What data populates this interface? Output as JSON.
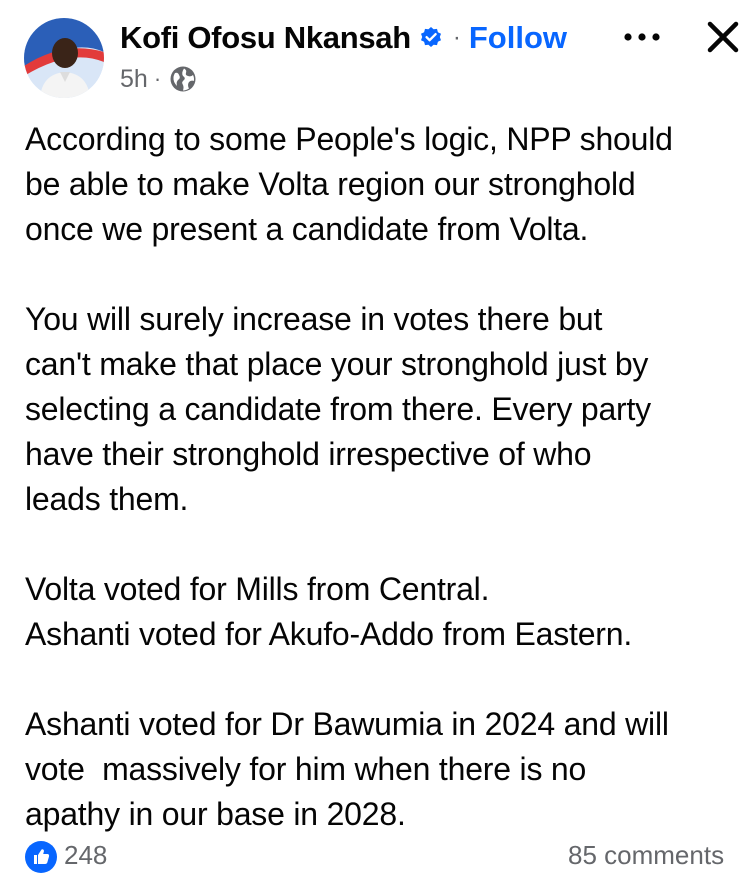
{
  "post": {
    "author": "Kofi Ofosu Nkansah",
    "separator": "·",
    "follow_label": "Follow",
    "time": "5h",
    "meta_separator": "·",
    "icons": {
      "verified": "verified-badge-icon",
      "more": "more-options-icon",
      "close": "close-icon",
      "audience": "globe-icon",
      "like": "like-reaction-icon"
    },
    "colors": {
      "accent": "#0866ff",
      "secondary_text": "#65676b",
      "text": "#050505"
    },
    "paragraphs": [
      [
        "According to some People's logic, NPP should",
        "be able to make Volta region our stronghold",
        "once we present a candidate from Volta."
      ],
      [
        "You will surely increase in votes there but",
        "can't make that place your stronghold just by",
        "selecting a candidate from there. Every party",
        "have their stronghold irrespective of who",
        "leads them."
      ],
      [
        "Volta voted for Mills from Central.",
        "Ashanti voted for Akufo-Addo from Eastern."
      ],
      [
        "Ashanti voted for Dr Bawumia in 2024 and will",
        "vote  massively for him when there is no",
        "apathy in our base in 2028."
      ]
    ]
  },
  "footer": {
    "likes": "248",
    "comments": "85 comments"
  }
}
